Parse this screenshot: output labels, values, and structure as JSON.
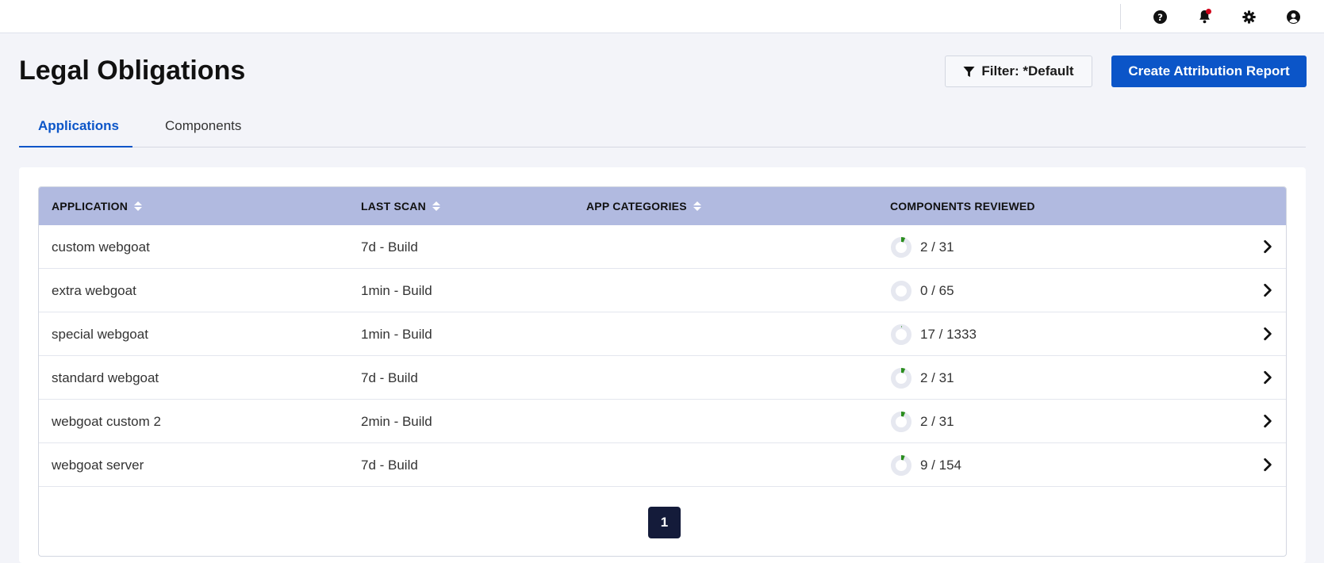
{
  "colors": {
    "accent": "#0b55c8",
    "header_bg": "#b1bae0",
    "page_btn_bg": "#141b3a",
    "progress_green": "#2a8d1e",
    "notification_red": "#d0021b",
    "donut_track": "#e6e8f0"
  },
  "topbar": {
    "icons": [
      "help-icon",
      "bell-icon",
      "gear-icon",
      "user-icon"
    ]
  },
  "page": {
    "title": "Legal Obligations"
  },
  "toolbar": {
    "filter_label": "Filter: *Default",
    "create_label": "Create Attribution Report"
  },
  "tabs": [
    {
      "label": "Applications",
      "active": true
    },
    {
      "label": "Components",
      "active": false
    }
  ],
  "table": {
    "headers": {
      "application": "APPLICATION",
      "last_scan": "LAST SCAN",
      "app_categories": "APP CATEGORIES",
      "components_reviewed": "COMPONENTS REVIEWED"
    },
    "rows": [
      {
        "application": "custom webgoat",
        "last_scan": "7d - Build",
        "categories": "",
        "reviewed": "2 / 31",
        "reviewed_count": 2,
        "total": 31
      },
      {
        "application": "extra webgoat",
        "last_scan": "1min - Build",
        "categories": "",
        "reviewed": "0 / 65",
        "reviewed_count": 0,
        "total": 65
      },
      {
        "application": "special webgoat",
        "last_scan": "1min - Build",
        "categories": "",
        "reviewed": "17 / 1333",
        "reviewed_count": 17,
        "total": 1333
      },
      {
        "application": "standard webgoat",
        "last_scan": "7d - Build",
        "categories": "",
        "reviewed": "2 / 31",
        "reviewed_count": 2,
        "total": 31
      },
      {
        "application": "webgoat custom 2",
        "last_scan": "2min - Build",
        "categories": "",
        "reviewed": "2 / 31",
        "reviewed_count": 2,
        "total": 31
      },
      {
        "application": "webgoat server",
        "last_scan": "7d - Build",
        "categories": "",
        "reviewed": "9 / 154",
        "reviewed_count": 9,
        "total": 154
      }
    ]
  },
  "pagination": {
    "current": "1"
  }
}
